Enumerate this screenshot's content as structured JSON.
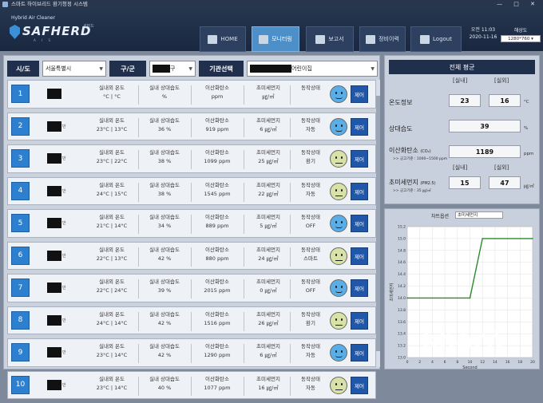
{
  "window_title": "스마트 하이브리드 환기청정 시스템",
  "logo": {
    "subtitle": "Hybrid Air Cleaner",
    "brand": "SAFHERD",
    "brand_kr": "세퍼드",
    "tagline": "A I S"
  },
  "nav": [
    {
      "label": "HOME",
      "icon": "home-icon",
      "active": false
    },
    {
      "label": "모니터링",
      "icon": "monitor-icon",
      "active": true
    },
    {
      "label": "보고서",
      "icon": "report-icon",
      "active": false
    },
    {
      "label": "정비이력",
      "icon": "maintenance-icon",
      "active": false
    },
    {
      "label": "Logout",
      "icon": "logout-icon",
      "active": false
    }
  ],
  "clock": {
    "time": "오전 11:03",
    "date": "2020-11-16"
  },
  "scale": {
    "label": "해상도",
    "value": "1280*760"
  },
  "filters": {
    "sido_label": "시/도",
    "sido_value": "서울특별시",
    "gugun_label": "구/군",
    "gugun_suffix": "구",
    "org_label": "기관선택",
    "org_suffix": "어린이집"
  },
  "rows": [
    {
      "num": "1",
      "han": "",
      "temp_label": "실내외 온도",
      "temp": "°C | °C",
      "hum_label": "실내 상대습도",
      "hum": "%",
      "co2_label": "이산화탄소",
      "co2": "ppm",
      "pm_label": "초미세먼지",
      "pm": "㎍/㎥",
      "st_label": "동작상태",
      "st": "",
      "face": "good",
      "ctrl": "제어"
    },
    {
      "num": "2",
      "han": "반",
      "temp_label": "실내외 온도",
      "temp": "23°C | 13°C",
      "hum_label": "실내 상대습도",
      "hum": "36 %",
      "co2_label": "이산화탄소",
      "co2": "919 ppm",
      "pm_label": "초미세먼지",
      "pm": "6 ㎍/㎥",
      "st_label": "동작상태",
      "st": "자동",
      "face": "good",
      "ctrl": "제어"
    },
    {
      "num": "3",
      "han": "반",
      "temp_label": "실내외 온도",
      "temp": "23°C | 22°C",
      "hum_label": "실내 상대습도",
      "hum": "38 %",
      "co2_label": "이산화탄소",
      "co2": "1099 ppm",
      "pm_label": "초미세먼지",
      "pm": "25 ㎍/㎥",
      "st_label": "동작상태",
      "st": "환기",
      "face": "mid",
      "ctrl": "제어"
    },
    {
      "num": "4",
      "han": "반",
      "temp_label": "실내외 온도",
      "temp": "24°C | 15°C",
      "hum_label": "실내 상대습도",
      "hum": "38 %",
      "co2_label": "이산화탄소",
      "co2": "1545 ppm",
      "pm_label": "초미세먼지",
      "pm": "22 ㎍/㎥",
      "st_label": "동작상태",
      "st": "자동",
      "face": "mid",
      "ctrl": "제어"
    },
    {
      "num": "5",
      "han": "반",
      "temp_label": "실내외 온도",
      "temp": "21°C | 14°C",
      "hum_label": "실내 상대습도",
      "hum": "34 %",
      "co2_label": "이산화탄소",
      "co2": "889 ppm",
      "pm_label": "초미세먼지",
      "pm": "5 ㎍/㎥",
      "st_label": "동작상태",
      "st": "OFF",
      "face": "good",
      "ctrl": "제어"
    },
    {
      "num": "6",
      "han": "반",
      "temp_label": "실내외 온도",
      "temp": "22°C | 13°C",
      "hum_label": "실내 상대습도",
      "hum": "42 %",
      "co2_label": "이산화탄소",
      "co2": "880 ppm",
      "pm_label": "초미세먼지",
      "pm": "24 ㎍/㎥",
      "st_label": "동작상태",
      "st": "스마트",
      "face": "mid",
      "ctrl": "제어"
    },
    {
      "num": "7",
      "han": "반",
      "temp_label": "실내외 온도",
      "temp": "22°C | 24°C",
      "hum_label": "실내 상대습도",
      "hum": "39 %",
      "co2_label": "이산화탄소",
      "co2": "2015 ppm",
      "pm_label": "초미세먼지",
      "pm": "0 ㎍/㎥",
      "st_label": "동작상태",
      "st": "OFF",
      "face": "good",
      "ctrl": "제어"
    },
    {
      "num": "8",
      "han": "반",
      "temp_label": "실내외 온도",
      "temp": "24°C | 14°C",
      "hum_label": "실내 상대습도",
      "hum": "42 %",
      "co2_label": "이산화탄소",
      "co2": "1516 ppm",
      "pm_label": "초미세먼지",
      "pm": "26 ㎍/㎥",
      "st_label": "동작상태",
      "st": "환기",
      "face": "mid",
      "ctrl": "제어"
    },
    {
      "num": "9",
      "han": "반",
      "temp_label": "실내외 온도",
      "temp": "23°C | 14°C",
      "hum_label": "실내 상대습도",
      "hum": "42 %",
      "co2_label": "이산화탄소",
      "co2": "1290 ppm",
      "pm_label": "초미세먼지",
      "pm": "6 ㎍/㎥",
      "st_label": "동작상태",
      "st": "자동",
      "face": "good",
      "ctrl": "제어"
    },
    {
      "num": "10",
      "han": "반",
      "temp_label": "실내외 온도",
      "temp": "23°C | 14°C",
      "hum_label": "실내 상대습도",
      "hum": "40 %",
      "co2_label": "이산화탄소",
      "co2": "1077 ppm",
      "pm_label": "초미세먼지",
      "pm": "16 ㎍/㎥",
      "st_label": "동작상태",
      "st": "자동",
      "face": "mid",
      "ctrl": "제어"
    }
  ],
  "average": {
    "title": "전체 평균",
    "indoor": "[실내]",
    "outdoor": "[실외]",
    "temp_label": "온도정보",
    "temp_in": "23",
    "temp_out": "16",
    "temp_unit": "°C",
    "hum_label": "상대습도",
    "hum": "39",
    "hum_unit": "%",
    "co2_label": "이산화탄소",
    "co2_sub": "(CO₂)",
    "co2": "1189",
    "co2_unit": "ppm",
    "co2_note": ">> 공고기준 : 1000~1500 ppm",
    "pm_label": "초미세먼지",
    "pm_sub": "(PM2.5)",
    "pm_in": "15",
    "pm_out": "47",
    "pm_unit": "㎍/㎥",
    "pm_note": ">> 공고기준 : 35 ㎍/㎥"
  },
  "chart_options": {
    "label": "차트옵션",
    "value": "초미세먼지"
  },
  "watermark": {
    "main": "kharn",
    "sub": "국제합동 연구소(한국) 연구실"
  },
  "chart_data": {
    "type": "line",
    "xlabel": "Second",
    "ylabel": "초미세먼지",
    "ylim": [
      13.0,
      15.2
    ],
    "xlim": [
      0,
      20
    ],
    "x_ticks": [
      0,
      2,
      4,
      6,
      8,
      10,
      12,
      14,
      16,
      18,
      20
    ],
    "y_ticks": [
      13.0,
      13.2,
      13.4,
      13.6,
      13.8,
      14.0,
      14.2,
      14.4,
      14.6,
      14.8,
      15.0,
      15.2
    ],
    "x": [
      0,
      10,
      12,
      20
    ],
    "y": [
      14.0,
      14.0,
      15.0,
      15.0
    ],
    "color": "#2a8a2a",
    "grid": true
  }
}
